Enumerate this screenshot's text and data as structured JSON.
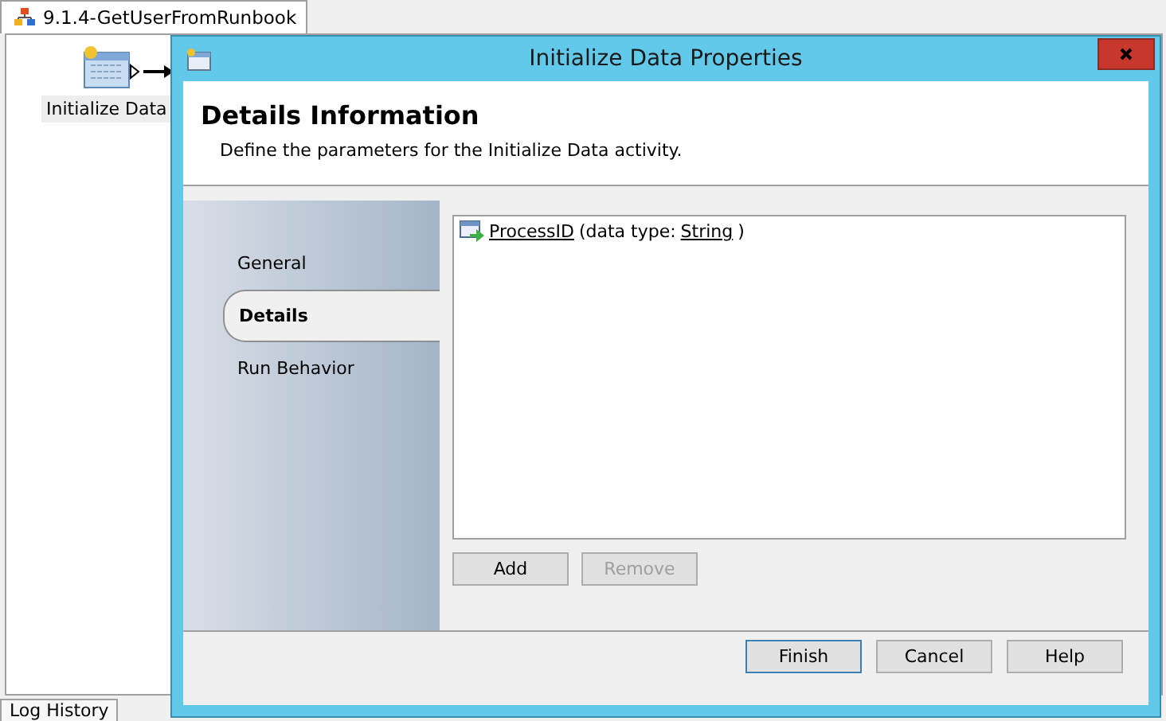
{
  "document_tab": {
    "title": "9.1.4-GetUserFromRunbook"
  },
  "canvas": {
    "activities": [
      {
        "label": "Initialize Data"
      }
    ]
  },
  "bottom_tabs": [
    "Log History"
  ],
  "dialog": {
    "title": "Initialize Data Properties",
    "header": {
      "title": "Details Information",
      "description": "Define the parameters for the Initialize Data activity."
    },
    "nav": [
      {
        "label": "General",
        "selected": false
      },
      {
        "label": "Details",
        "selected": true
      },
      {
        "label": "Run Behavior",
        "selected": false
      }
    ],
    "parameters": [
      {
        "name": "ProcessID",
        "prefix": "(data type:",
        "type": "String",
        "suffix": ")"
      }
    ],
    "list_buttons": [
      {
        "label": "Add",
        "disabled": false
      },
      {
        "label": "Remove",
        "disabled": true
      }
    ],
    "buttons": [
      {
        "label": "Finish",
        "default": true
      },
      {
        "label": "Cancel",
        "default": false
      },
      {
        "label": "Help",
        "default": false
      }
    ]
  }
}
